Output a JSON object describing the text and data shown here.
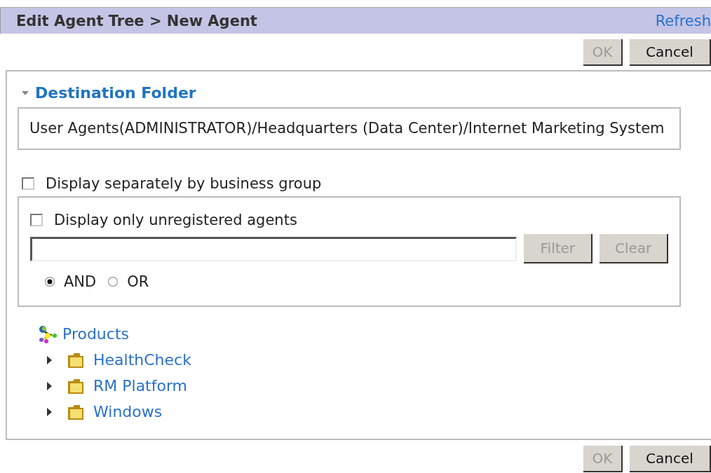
{
  "header": {
    "title": "Edit Agent Tree > New Agent",
    "refresh_link": "Refresh"
  },
  "top_buttons": [
    {
      "label": "OK",
      "disabled": true
    },
    {
      "label": "Cancel",
      "disabled": false
    }
  ],
  "destination": {
    "title": "Destination Folder",
    "expanded": true,
    "path": "User Agents(ADMINISTRATOR)/Headquarters (Data Center)/Internet Marketing System"
  },
  "display_separately": {
    "label": "Display separately by business group",
    "checked": false
  },
  "filter_panel": {
    "unregistered": {
      "label": "Display only unregistered agents",
      "checked": false
    },
    "buttons": [
      {
        "label": "Filter",
        "disabled": true
      },
      {
        "label": "Clear",
        "disabled": true
      }
    ],
    "logic": [
      {
        "label": "AND",
        "selected": true
      },
      {
        "label": "OR",
        "selected": false
      }
    ]
  },
  "tree": {
    "label": "Products",
    "children": [
      {
        "label": "HealthCheck",
        "expanded": false
      },
      {
        "label": "RM Platform",
        "expanded": false
      },
      {
        "label": "Windows",
        "expanded": false
      }
    ]
  },
  "bottom_buttons": [
    {
      "label": "OK",
      "disabled": true
    },
    {
      "label": "Cancel",
      "disabled": false
    }
  ]
}
